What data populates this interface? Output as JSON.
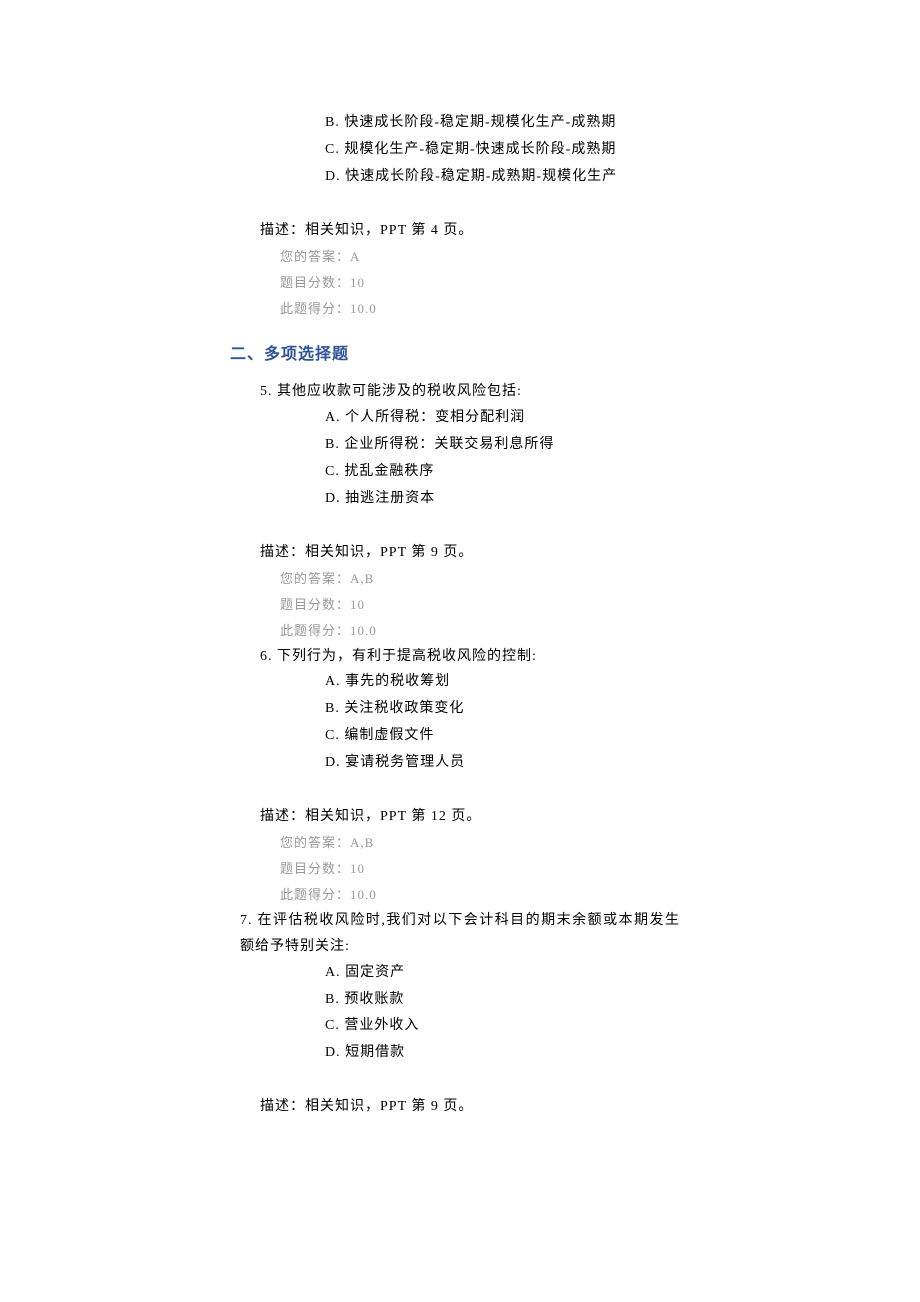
{
  "q4": {
    "options": {
      "B": "B. 快速成长阶段-稳定期-规模化生产-成熟期",
      "C": "C. 规模化生产-稳定期-快速成长阶段-成熟期",
      "D": "D. 快速成长阶段-稳定期-成熟期-规模化生产"
    },
    "desc": "描述：相关知识，PPT 第 4 页。",
    "answer": "您的答案：A",
    "score": "题目分数：10",
    "got": "此题得分：10.0"
  },
  "section2": "二、多项选择题",
  "q5": {
    "stem": "5. 其他应收款可能涉及的税收风险包括:",
    "options": {
      "A": "A. 个人所得税：变相分配利润",
      "B": "B. 企业所得税：关联交易利息所得",
      "C": "C. 扰乱金融秩序",
      "D": "D. 抽逃注册资本"
    },
    "desc": "描述：相关知识，PPT 第 9 页。",
    "answer": "您的答案：A,B",
    "score": "题目分数：10",
    "got": "此题得分：10.0"
  },
  "q6": {
    "stem": "6. 下列行为，有利于提高税收风险的控制:",
    "options": {
      "A": "A. 事先的税收筹划",
      "B": "B. 关注税收政策变化",
      "C": "C. 编制虚假文件",
      "D": "D. 宴请税务管理人员"
    },
    "desc": "描述：相关知识，PPT 第 12 页。",
    "answer": "您的答案：A,B",
    "score": "题目分数：10",
    "got": "此题得分：10.0"
  },
  "q7": {
    "stem_line1": "7. 在评估税收风险时,我们对以下会计科目的期末余额或本期发生",
    "stem_line2": "额给予特别关注:",
    "options": {
      "A": "A. 固定资产",
      "B": "B. 预收账款",
      "C": "C. 营业外收入",
      "D": "D. 短期借款"
    },
    "desc": "描述：相关知识，PPT 第 9 页。"
  }
}
